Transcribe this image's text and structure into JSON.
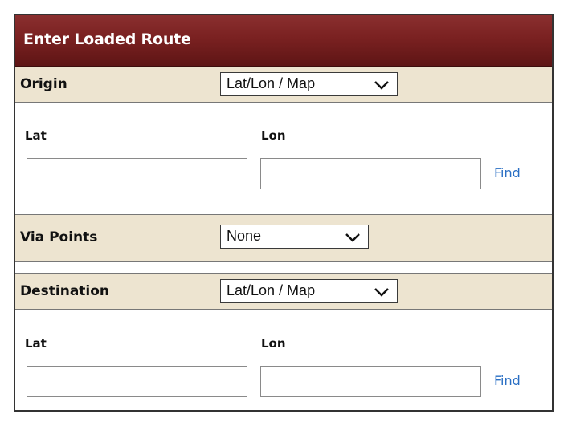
{
  "panel": {
    "title": "Enter Loaded Route"
  },
  "origin": {
    "label": "Origin",
    "mode_selected": "Lat/Lon / Map",
    "lat_label": "Lat",
    "lon_label": "Lon",
    "lat_value": "",
    "lon_value": "",
    "find_label": "Find"
  },
  "via": {
    "label": "Via Points",
    "selected": "None"
  },
  "destination": {
    "label": "Destination",
    "mode_selected": "Lat/Lon / Map",
    "lat_label": "Lat",
    "lon_label": "Lon",
    "lat_value": "",
    "lon_value": "",
    "find_label": "Find"
  },
  "icons": {
    "dropdown": "chevron-down-icon"
  },
  "colors": {
    "header_bg": "#7a2121",
    "band_bg": "#ede4d0",
    "link": "#2a6fc4"
  }
}
